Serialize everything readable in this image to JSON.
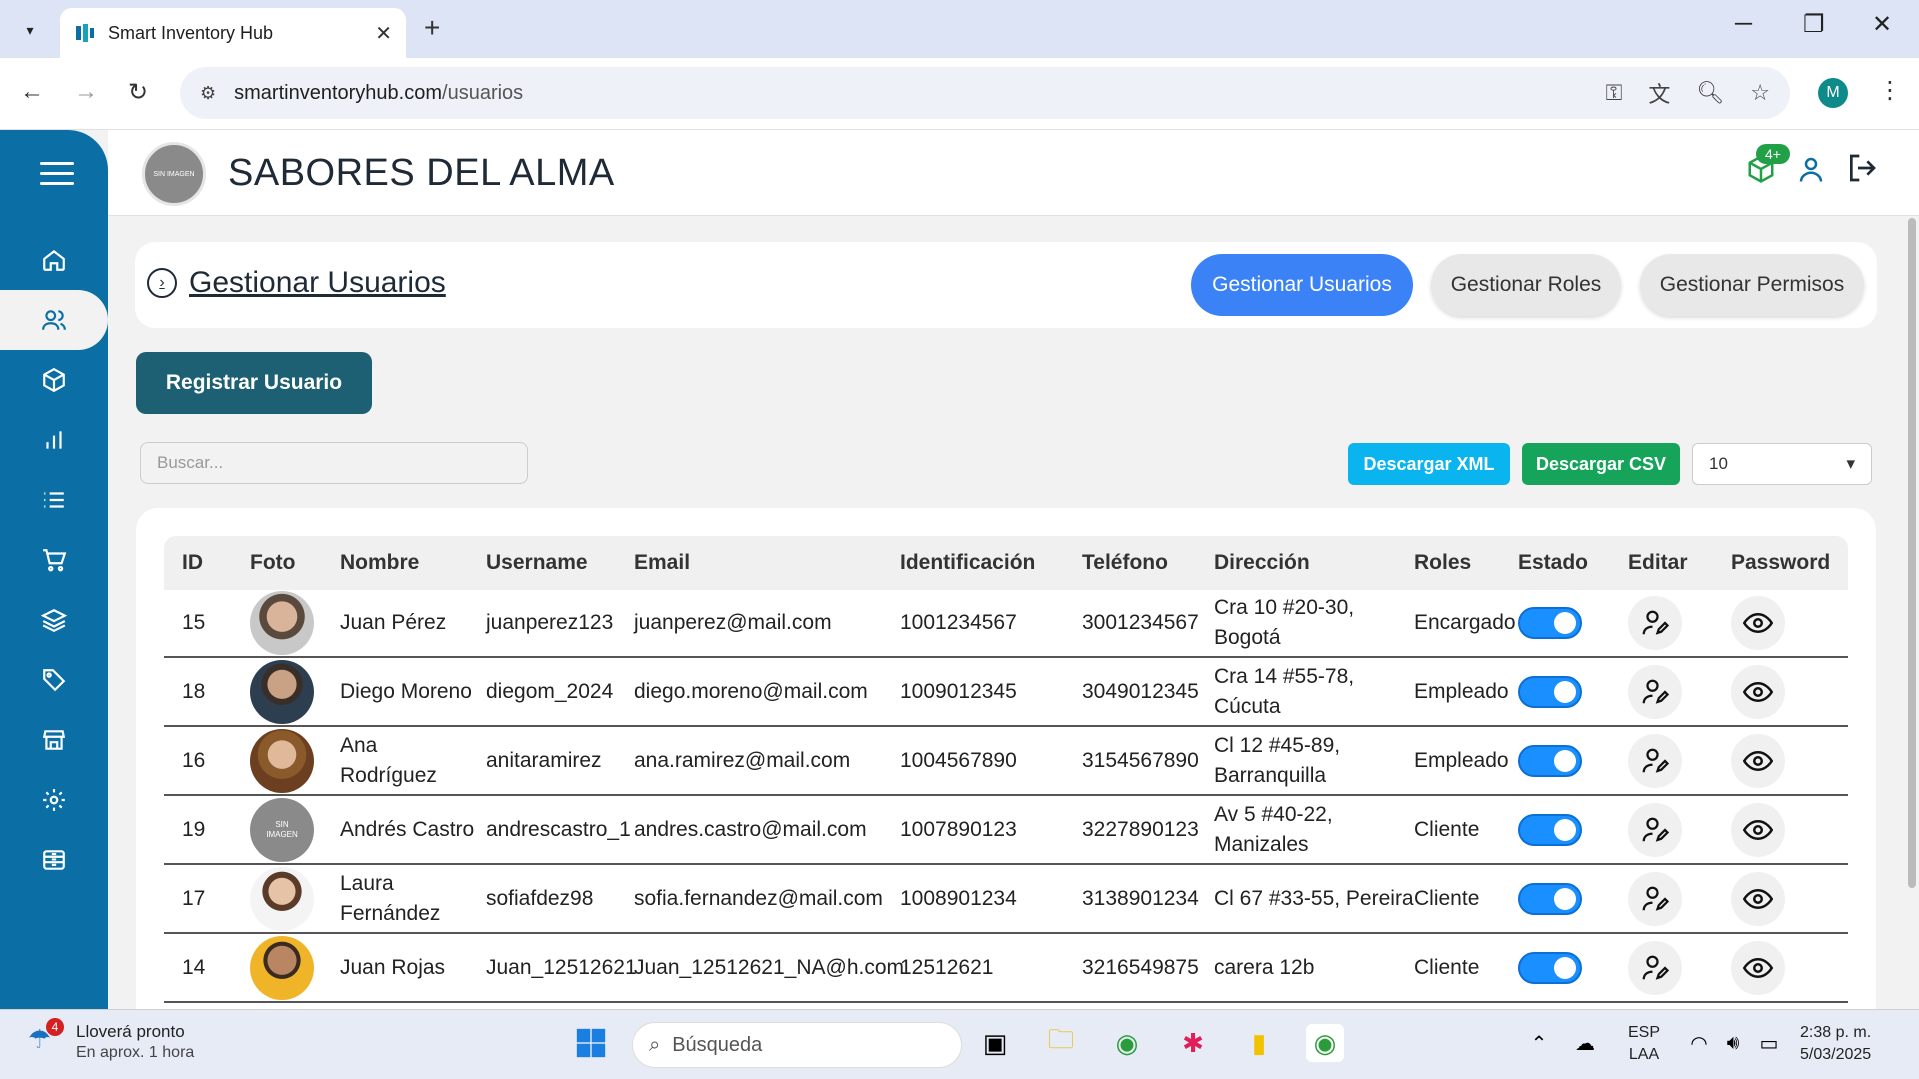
{
  "browser": {
    "tab_title": "Smart Inventory Hub",
    "url_domain": "smartinventoryhub.com",
    "url_path": "/usuarios",
    "profile_initial": "M"
  },
  "header": {
    "logo_text": "SIN IMAGEN",
    "company": "SABORES DEL ALMA",
    "notif_badge": "4+"
  },
  "section": {
    "title": "Gestionar Usuarios",
    "tabs": [
      {
        "label": "Gestionar Usuarios",
        "active": true
      },
      {
        "label": "Gestionar Roles",
        "active": false
      },
      {
        "label": "Gestionar Permisos",
        "active": false
      }
    ]
  },
  "actions": {
    "register": "Registrar Usuario",
    "search_placeholder": "Buscar...",
    "download_xml": "Descargar XML",
    "download_csv": "Descargar CSV",
    "page_size": "10"
  },
  "table": {
    "headers": [
      "ID",
      "Foto",
      "Nombre",
      "Username",
      "Email",
      "Identificación",
      "Teléfono",
      "Dirección",
      "Roles",
      "Estado",
      "Editar",
      "Password"
    ],
    "rows": [
      {
        "id": "15",
        "nombre": "Juan Pérez",
        "username": "juanperez123",
        "email": "juanperez@mail.com",
        "identificacion": "1001234567",
        "telefono": "3001234567",
        "direccion": "Cra 10 #20-30, Bogotá",
        "rol": "Encargado",
        "estado": true,
        "foto": "photo-man-glasses"
      },
      {
        "id": "18",
        "nombre": "Diego Moreno",
        "username": "diegom_2024",
        "email": "diego.moreno@mail.com",
        "identificacion": "1009012345",
        "telefono": "3049012345",
        "direccion": "Cra 14 #55-78, Cúcuta",
        "rol": "Empleado",
        "estado": true,
        "foto": "photo-man-suit"
      },
      {
        "id": "16",
        "nombre": "Ana Rodríguez",
        "username": "anitaramirez",
        "email": "ana.ramirez@mail.com",
        "identificacion": "1004567890",
        "telefono": "3154567890",
        "direccion": "Cl 12 #45-89, Barranquilla",
        "rol": "Empleado",
        "estado": true,
        "foto": "photo-woman-smiling"
      },
      {
        "id": "19",
        "nombre": "Andrés Castro",
        "username": "andrescastro_1",
        "email": "andres.castro@mail.com",
        "identificacion": "1007890123",
        "telefono": "3227890123",
        "direccion": "Av 5 #40-22, Manizales",
        "rol": "Cliente",
        "estado": true,
        "foto": "no-image"
      },
      {
        "id": "17",
        "nombre": "Laura Fernández",
        "username": "sofiafdez98",
        "email": "sofia.fernandez@mail.com",
        "identificacion": "1008901234",
        "telefono": "3138901234",
        "direccion": "Cl 67 #33-55, Pereira",
        "rol": "Cliente",
        "estado": true,
        "foto": "photo-woman-white"
      },
      {
        "id": "14",
        "nombre": "Juan Rojas",
        "username": "Juan_12512621",
        "email": "Juan_12512621_NA@h.com",
        "identificacion": "12512621",
        "telefono": "3216549875",
        "direccion": "carera 12b",
        "rol": "Cliente",
        "estado": true,
        "foto": "photo-man-yellow"
      }
    ]
  },
  "taskbar": {
    "weather_title": "Lloverá pronto",
    "weather_sub": "En aprox. 1 hora",
    "weather_badge": "4",
    "search_placeholder": "Búsqueda",
    "lang1": "ESP",
    "lang2": "LAA",
    "time": "2:38 p. m.",
    "date": "5/03/2025"
  }
}
